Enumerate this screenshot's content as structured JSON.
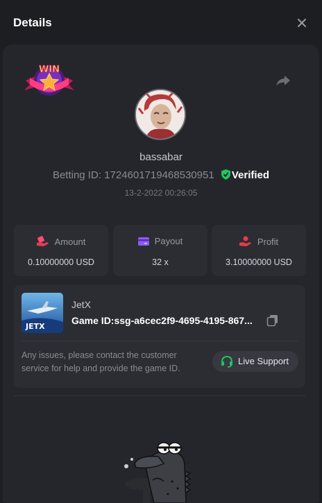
{
  "header": {
    "title": "Details"
  },
  "icons": {
    "close": "close-icon",
    "share": "share-icon",
    "verified": "shield-check-icon",
    "copy": "copy-icon",
    "headset": "headset-icon",
    "win_badge": "win-badge-icon"
  },
  "win_badge_text": "WIN",
  "user": {
    "name": "bassabar",
    "betting_id_label": "Betting ID:",
    "betting_id": "1724601719468530951",
    "verified_label": "Verified",
    "date": "13-2-2022 00:26:05"
  },
  "stats": [
    {
      "label": "Amount",
      "value": "0.10000000 USD",
      "icon": "hand-coin-icon",
      "color": "#ff4d6d"
    },
    {
      "label": "Payout",
      "value": "32 x",
      "icon": "card-icon",
      "color": "#8b5cf6"
    },
    {
      "label": "Profit",
      "value": "3.10000000 USD",
      "icon": "hand-profit-icon",
      "color": "#e43c4a"
    }
  ],
  "game": {
    "name": "JetX",
    "thumb_label": "JETX",
    "id_label": "Game ID:",
    "id": "ssg-a6cec2f9-4695-4195-867...",
    "help_text": "Any issues, please contact the customer service for help and provide the game ID.",
    "support_label": "Live Support"
  },
  "colors": {
    "background": "#1d1e22",
    "card": "#25262b",
    "tile": "#2c2d33",
    "verified": "#22c55e",
    "support_icon": "#22c55e"
  }
}
